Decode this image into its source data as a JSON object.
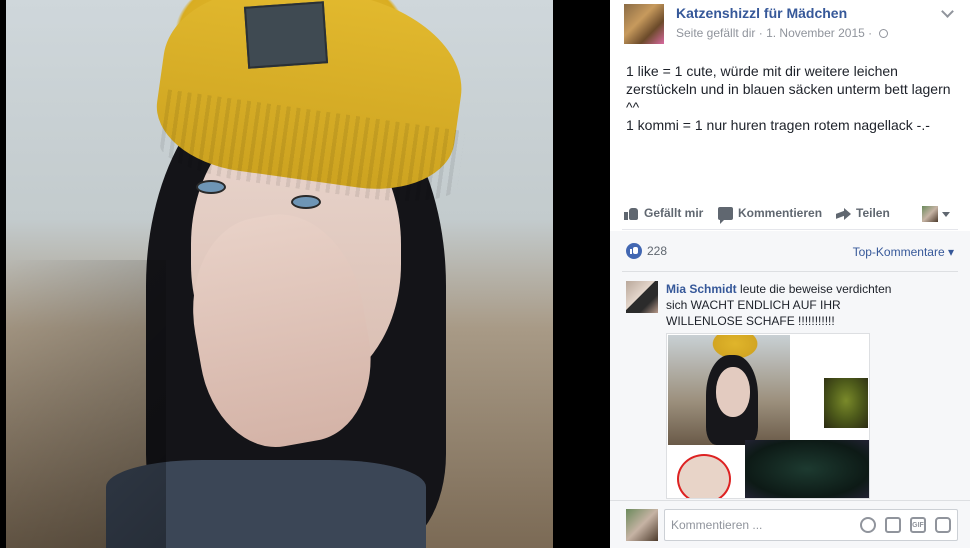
{
  "post": {
    "page_name": "Katzenshizzl für Mädchen",
    "liked_label": "Seite gefällt dir",
    "separator": "·",
    "date": "1. November 2015",
    "separator2": "·",
    "text_line1": "1 like = 1 cute, würde mit dir weitere leichen zerstückeln und in blauen säcken unterm bett lagern ^^",
    "text_line2": "1 kommi = 1 nur huren tragen rotem nagellack -.-"
  },
  "actions": {
    "like": "Gefällt mir",
    "comment": "Kommentieren",
    "share": "Teilen"
  },
  "reactions": {
    "count": "228",
    "sort_label": "Top-Kommentare"
  },
  "comment": {
    "author": "Mia Schmidt",
    "text": " leute die beweise verdichten sich WACHT ENDLICH AUF IHR WILLENLOSE SCHAFE !!!!!!!!!!!"
  },
  "composer": {
    "placeholder": "Kommentieren ...",
    "gif_label": "GIF"
  },
  "icons": [
    "like-icon",
    "comment-icon",
    "share-icon",
    "globe-icon",
    "chevron-down-icon",
    "emoji-icon",
    "camera-icon",
    "gif-icon",
    "sticker-icon"
  ],
  "colors": {
    "link": "#365899",
    "text": "#1d2129",
    "muted": "#90949c",
    "like_badge": "#4267b2",
    "background": "#000000"
  }
}
